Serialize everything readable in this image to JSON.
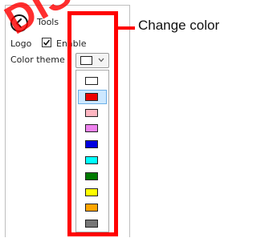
{
  "panel": {
    "tools_label": "Tools",
    "logo_label": "Logo",
    "logo_enabled": true,
    "enable_label": "Enable",
    "color_theme_label": "Color theme",
    "selected_color": "#ffffff"
  },
  "dropdown": {
    "options": [
      {
        "name": "white",
        "color": "#ffffff",
        "selected": false
      },
      {
        "name": "red",
        "color": "#ee0000",
        "selected": true
      },
      {
        "name": "pink",
        "color": "#ffb6c1",
        "selected": false
      },
      {
        "name": "violet",
        "color": "#ee82ee",
        "selected": false
      },
      {
        "name": "blue",
        "color": "#0000e0",
        "selected": false
      },
      {
        "name": "cyan",
        "color": "#00ffff",
        "selected": false
      },
      {
        "name": "green",
        "color": "#007a00",
        "selected": false
      },
      {
        "name": "yellow",
        "color": "#ffff00",
        "selected": false
      },
      {
        "name": "orange",
        "color": "#ffa500",
        "selected": false
      },
      {
        "name": "gray",
        "color": "#777777",
        "selected": false
      }
    ]
  },
  "annotation": {
    "text": "Change color",
    "color": "#ff0000"
  },
  "watermark": {
    "text": "DIS"
  }
}
